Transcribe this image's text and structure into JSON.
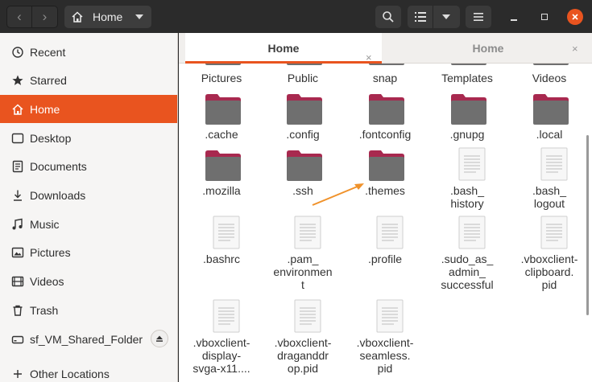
{
  "header": {
    "path_label": "Home"
  },
  "sidebar": {
    "items": [
      {
        "label": "Recent",
        "icon": "clock-icon"
      },
      {
        "label": "Starred",
        "icon": "star-icon"
      },
      {
        "label": "Home",
        "icon": "home-icon",
        "active": true
      },
      {
        "label": "Desktop",
        "icon": "desktop-icon"
      },
      {
        "label": "Documents",
        "icon": "documents-icon"
      },
      {
        "label": "Downloads",
        "icon": "download-icon"
      },
      {
        "label": "Music",
        "icon": "music-icon"
      },
      {
        "label": "Pictures",
        "icon": "pictures-icon"
      },
      {
        "label": "Videos",
        "icon": "videos-icon"
      },
      {
        "label": "Trash",
        "icon": "trash-icon"
      },
      {
        "label": "sf_VM_Shared_Folder",
        "icon": "drive-icon"
      },
      {
        "label": "Other Locations",
        "icon": "plus-icon"
      }
    ]
  },
  "tabs": [
    {
      "label": "Home",
      "close": "×"
    },
    {
      "label": "Home",
      "close": "×"
    }
  ],
  "files": {
    "row0": [
      "Pictures",
      "Public",
      "snap",
      "Templates",
      "Videos"
    ],
    "row1": [
      ".cache",
      ".config",
      ".fontconfig",
      ".gnupg",
      ".local"
    ],
    "row2": [
      {
        "l1": ".mozilla",
        "l2": "",
        "type": "folder"
      },
      {
        "l1": ".ssh",
        "l2": "",
        "type": "folder"
      },
      {
        "l1": ".themes",
        "l2": "",
        "type": "folder"
      },
      {
        "l1": ".bash_",
        "l2": "history",
        "type": "file"
      },
      {
        "l1": ".bash_",
        "l2": "logout",
        "type": "file"
      }
    ],
    "row3": [
      {
        "l1": ".bashrc",
        "l2": "",
        "l3": ""
      },
      {
        "l1": ".pam_",
        "l2": "environmen",
        "l3": "t"
      },
      {
        "l1": ".profile",
        "l2": "",
        "l3": ""
      },
      {
        "l1": ".sudo_as_",
        "l2": "admin_",
        "l3": "successful"
      },
      {
        "l1": ".vboxclient-",
        "l2": "clipboard.",
        "l3": "pid"
      }
    ],
    "row4": [
      {
        "l1": ".vboxclient-",
        "l2": "display-",
        "l3": "svga-x11...."
      },
      {
        "l1": ".vboxclient-",
        "l2": "draganddr",
        "l3": "op.pid"
      },
      {
        "l1": ".vboxclient-",
        "l2": "seamless.",
        "l3": "pid"
      }
    ]
  },
  "colors": {
    "accent": "#e9541f",
    "folder_top": "#a8294f",
    "folder_body": "#6f6f6f"
  }
}
